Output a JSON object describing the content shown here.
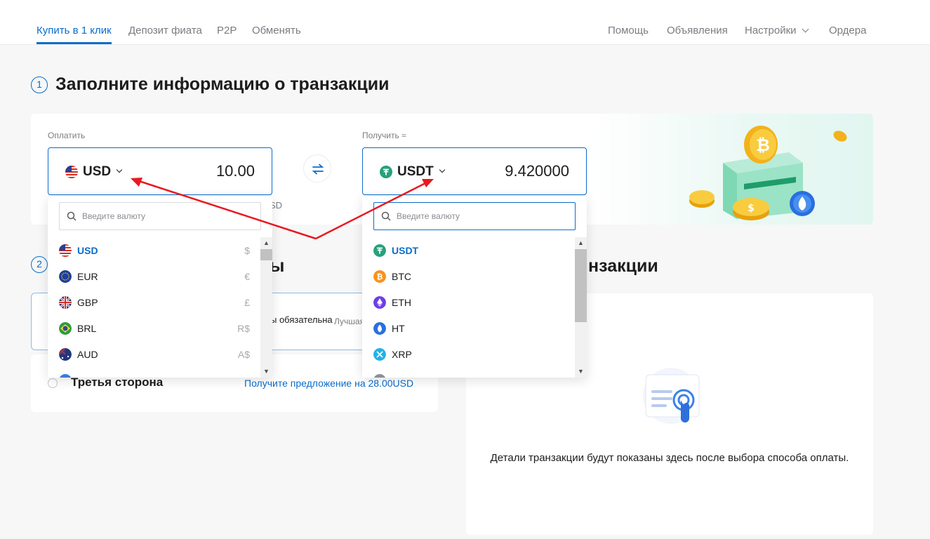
{
  "nav": {
    "left": [
      "Купить в 1 клик",
      "Депозит фиата",
      "P2P",
      "Обменять"
    ],
    "right": [
      "Помощь",
      "Объявления",
      "Настройки",
      "Ордера"
    ]
  },
  "step1": {
    "number": "1",
    "title": "Заполните информацию о транзакции"
  },
  "step2": {
    "number": "2",
    "title_tail": "ы"
  },
  "step3": {
    "title_tail": "нзакции"
  },
  "pay": {
    "label": "Оплатить",
    "currency": "USD",
    "amount": "10.00",
    "under_hint": "SD"
  },
  "receive": {
    "label": "Получить ≈",
    "currency": "USDT",
    "amount": "9.420000"
  },
  "fiat_dropdown": {
    "placeholder": "Введите валюту",
    "items": [
      {
        "code": "USD",
        "symbol": "$",
        "selected": true,
        "icon": "us-flag-icon"
      },
      {
        "code": "EUR",
        "symbol": "€",
        "selected": false,
        "icon": "eu-flag-icon"
      },
      {
        "code": "GBP",
        "symbol": "£",
        "selected": false,
        "icon": "uk-flag-icon"
      },
      {
        "code": "BRL",
        "symbol": "R$",
        "selected": false,
        "icon": "br-flag-icon"
      },
      {
        "code": "AUD",
        "symbol": "A$",
        "selected": false,
        "icon": "au-flag-icon"
      }
    ]
  },
  "crypto_dropdown": {
    "placeholder": "Введите валюту",
    "items": [
      {
        "code": "USDT",
        "selected": true,
        "color": "#26a17b",
        "icon": "tether-icon"
      },
      {
        "code": "BTC",
        "selected": false,
        "color": "#f7931a",
        "icon": "bitcoin-icon"
      },
      {
        "code": "ETH",
        "selected": false,
        "color": "#6d3ee8",
        "icon": "ethereum-icon"
      },
      {
        "code": "HT",
        "selected": false,
        "color": "#2a6fe0",
        "icon": "huobi-token-icon"
      },
      {
        "code": "XRP",
        "selected": false,
        "color": "#23b2e8",
        "icon": "xrp-icon"
      }
    ]
  },
  "payment": {
    "partial_text": "ы обязательна",
    "partial_best": "Лучшая",
    "third_party": "Третья сторона",
    "offer": "Получите предложение на 28.00USD"
  },
  "details": {
    "text": "Детали транзакции будут показаны здесь после выбора способа оплаты."
  },
  "colors": {
    "accent": "#0a6ccb",
    "annotation": "#e8191f"
  }
}
